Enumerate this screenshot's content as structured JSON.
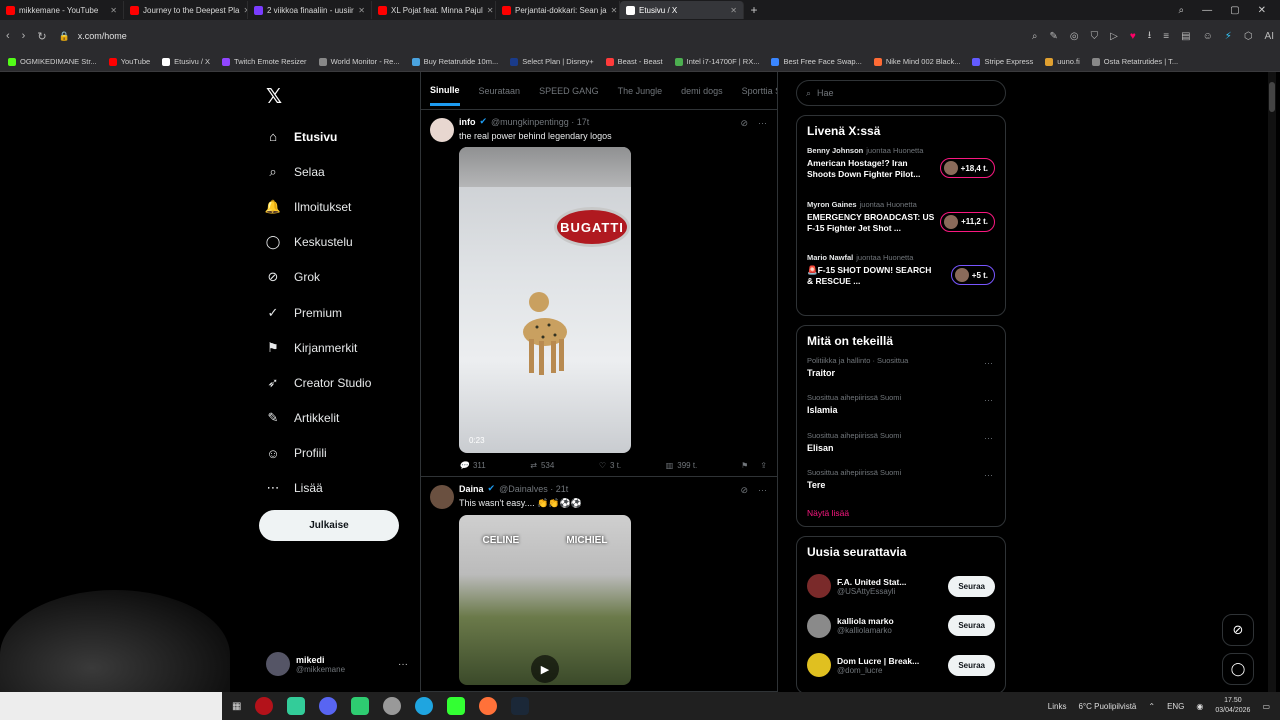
{
  "browser": {
    "tabs": [
      {
        "title": "mikkemane - YouTube",
        "color": "#ff0000",
        "active": false
      },
      {
        "title": "Journey to the Deepest Pla",
        "color": "#ff0000",
        "active": false
      },
      {
        "title": "2 viikkoa finaaliin - uusiir",
        "color": "#7a3cff",
        "active": false
      },
      {
        "title": "XL Pojat feat. Minna Pajul",
        "color": "#ff0000",
        "active": false
      },
      {
        "title": "Perjantai-dokkari: Sean ja",
        "color": "#ff0000",
        "active": false
      },
      {
        "title": "Etusivu / X",
        "color": "#ffffff",
        "active": true
      }
    ],
    "new_tab": "+",
    "url": "x.com/home",
    "bookmarks": [
      {
        "label": "OGMIKEDIMANE Str...",
        "color": "#53fc18"
      },
      {
        "label": "YouTube",
        "color": "#ff0000"
      },
      {
        "label": "Etusivu / X",
        "color": "#ffffff"
      },
      {
        "label": "Twitch Emote Resizer",
        "color": "#9146ff"
      },
      {
        "label": "World Monitor - Re...",
        "color": "#888888"
      },
      {
        "label": "Buy Retatrutide 10m...",
        "color": "#4aa3df"
      },
      {
        "label": "Select Plan | Disney+",
        "color": "#1a3b8a"
      },
      {
        "label": "Beast - Beast",
        "color": "#ff3b3b"
      },
      {
        "label": "Intel i7-14700F | RX...",
        "color": "#4caf50"
      },
      {
        "label": "Best Free Face Swap...",
        "color": "#3a86ff"
      },
      {
        "label": "Nike Mind 002 Black...",
        "color": "#ff6b35"
      },
      {
        "label": "Stripe Express",
        "color": "#635bff"
      },
      {
        "label": "uuno.fi",
        "color": "#e0a030"
      },
      {
        "label": "Osta Retatrutides | T...",
        "color": "#888888"
      }
    ]
  },
  "sidebar": {
    "logo": "𝕏",
    "items": [
      {
        "label": "Etusivu",
        "icon": "home-icon",
        "glyph": "⌂",
        "active": true
      },
      {
        "label": "Selaa",
        "icon": "search-icon",
        "glyph": "⌕",
        "active": false
      },
      {
        "label": "Ilmoitukset",
        "icon": "bell-icon",
        "glyph": "🔔",
        "active": false
      },
      {
        "label": "Keskustelu",
        "icon": "chat-icon",
        "glyph": "◯",
        "active": false
      },
      {
        "label": "Grok",
        "icon": "grok-icon",
        "glyph": "⊘",
        "active": false
      },
      {
        "label": "Premium",
        "icon": "premium-icon",
        "glyph": "✓",
        "active": false
      },
      {
        "label": "Kirjanmerkit",
        "icon": "bookmark-icon",
        "glyph": "⚑",
        "active": false
      },
      {
        "label": "Creator Studio",
        "icon": "rocket-icon",
        "glyph": "➶",
        "active": false
      },
      {
        "label": "Artikkelit",
        "icon": "article-icon",
        "glyph": "✎",
        "active": false
      },
      {
        "label": "Profiili",
        "icon": "profile-icon",
        "glyph": "☺",
        "active": false
      },
      {
        "label": "Lisää",
        "icon": "more-icon",
        "glyph": "⋯",
        "active": false
      }
    ],
    "post_button": "Julkaise",
    "profile": {
      "name": "mikedi",
      "handle": "@mikkemane"
    }
  },
  "feed": {
    "tabs": [
      "Sinulle",
      "Seurataan",
      "SPEED GANG",
      "The Jungle",
      "demi dogs",
      "Sporttia S"
    ],
    "active_tab": "Sinulle",
    "tweets": [
      {
        "name": "info",
        "handle": "@mungkinpentingg · 17t",
        "text": "the real power behind legendary logos",
        "media_badge": "BUGATTI",
        "video_time": "0:23",
        "replies": "311",
        "reposts": "534",
        "likes": "3 t.",
        "views": "399 t."
      },
      {
        "name": "Daina",
        "handle": "@Dainalves · 21t",
        "text": "This wasn't easy.... 👏👏⚽⚽",
        "media_names": [
          "CELINE",
          "MICHIEL"
        ]
      }
    ]
  },
  "right": {
    "search_placeholder": "Hae",
    "live": {
      "title": "Livenä X:ssä",
      "items": [
        {
          "host": "Benny Johnson",
          "note": "juontaa Huonetta",
          "text": "American Hostage!? Iran Shoots Down Fighter Pilot...",
          "count": "+18,4 t."
        },
        {
          "host": "Myron Gaines",
          "note": "juontaa Huonetta",
          "text": "EMERGENCY BROADCAST: US F-15 Fighter Jet Shot ...",
          "count": "+11,2 t."
        },
        {
          "host": "Mario Nawfal",
          "note": "juontaa Huonetta",
          "text": "🚨F-15 SHOT DOWN! SEARCH & RESCUE ...",
          "count": "+5 t."
        }
      ]
    },
    "trends": {
      "title": "Mitä on tekeillä",
      "items": [
        {
          "context": "Politiikka ja hallinto · Suosittua",
          "name": "Traitor"
        },
        {
          "context": "Suosittua aihepiirissä Suomi",
          "name": "Islamia"
        },
        {
          "context": "Suosittua aihepiirissä Suomi",
          "name": "Elisan"
        },
        {
          "context": "Suosittua aihepiirissä Suomi",
          "name": "Tere"
        }
      ],
      "show_more": "Näytä lisää"
    },
    "who_to_follow": {
      "title": "Uusia seurattavia",
      "items": [
        {
          "name": "F.A. United Stat...",
          "handle": "@USAttyEssayli",
          "button": "Seuraa",
          "color": "#7a2a2a"
        },
        {
          "name": "kalliola marko",
          "handle": "@kalliolamarko",
          "button": "Seuraa",
          "color": "#8a8a8a"
        },
        {
          "name": "Dom Lucre | Break...",
          "handle": "@dom_lucre",
          "button": "Seuraa",
          "color": "#e0c020"
        }
      ]
    }
  },
  "taskbar": {
    "links": "Links",
    "weather": "6°C  Puolipilvistä",
    "lang": "ENG",
    "time": "17.50",
    "date": "03/04/2026"
  }
}
